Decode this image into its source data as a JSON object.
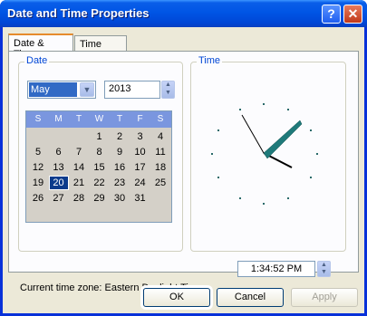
{
  "window": {
    "title": "Date and Time Properties",
    "help_label": "?",
    "close_label": "✕"
  },
  "tabs": [
    {
      "label": "Date & Time"
    },
    {
      "label": "Time Zone"
    }
  ],
  "date_group": {
    "label": "Date",
    "month": "May",
    "year": "2013",
    "weekdays": [
      "S",
      "M",
      "T",
      "W",
      "T",
      "F",
      "S"
    ],
    "weeks": [
      [
        "",
        "",
        "",
        "1",
        "2",
        "3",
        "4"
      ],
      [
        "5",
        "6",
        "7",
        "8",
        "9",
        "10",
        "11"
      ],
      [
        "12",
        "13",
        "14",
        "15",
        "16",
        "17",
        "18"
      ],
      [
        "19",
        "20",
        "21",
        "22",
        "23",
        "24",
        "25"
      ],
      [
        "26",
        "27",
        "28",
        "29",
        "30",
        "31",
        ""
      ]
    ],
    "selected_day": "20"
  },
  "time_group": {
    "label": "Time",
    "time": "1:34:52 PM"
  },
  "timezone_text": "Current time zone:  Eastern Daylight Time",
  "buttons": {
    "ok": "OK",
    "cancel": "Cancel",
    "apply": "Apply"
  },
  "colors": {
    "titlebar": "#0055e5",
    "calendar_header": "#7a96df",
    "selection": "#316ac5"
  }
}
